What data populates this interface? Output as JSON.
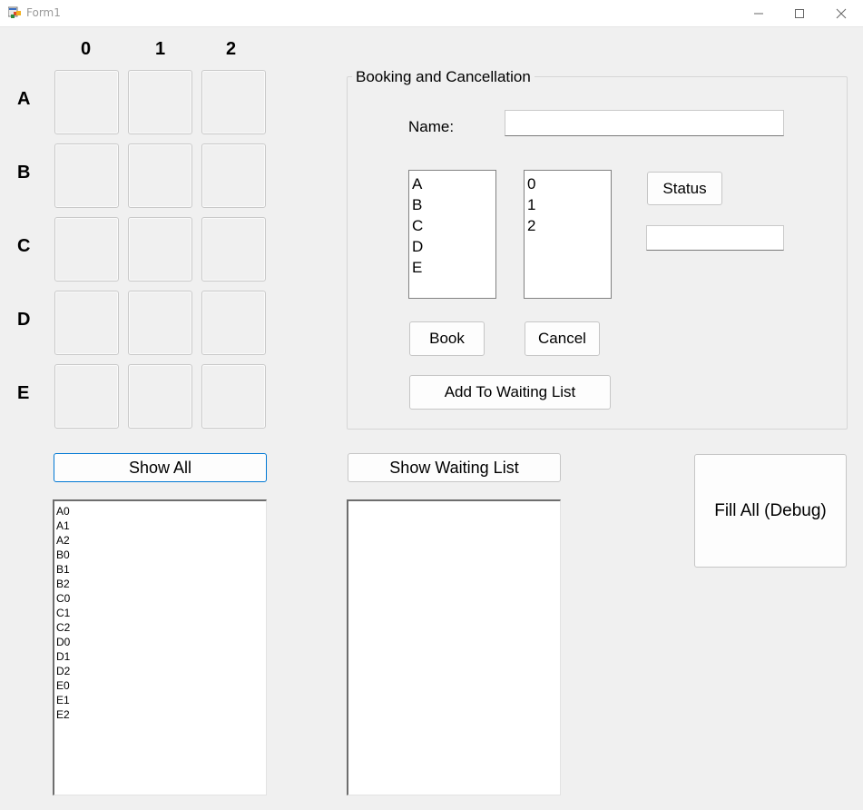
{
  "window": {
    "title": "Form1",
    "controls": [
      "minimize-icon",
      "maximize-icon",
      "close-icon"
    ]
  },
  "seat_grid": {
    "columns": [
      "0",
      "1",
      "2"
    ],
    "rows": [
      "A",
      "B",
      "C",
      "D",
      "E"
    ]
  },
  "booking": {
    "group_title": "Booking and Cancellation",
    "name_label": "Name:",
    "name_value": "",
    "row_options": [
      "A",
      "B",
      "C",
      "D",
      "E"
    ],
    "seat_options": [
      "0",
      "1",
      "2"
    ],
    "status_button": "Status",
    "status_value": "",
    "book_button": "Book",
    "cancel_button": "Cancel",
    "waiting_button": "Add To Waiting List"
  },
  "show_all": {
    "button": "Show All",
    "items": [
      "A0",
      "A1",
      "A2",
      "B0",
      "B1",
      "B2",
      "C0",
      "C1",
      "C2",
      "D0",
      "D1",
      "D2",
      "E0",
      "E1",
      "E2"
    ]
  },
  "waiting": {
    "button": "Show Waiting List",
    "items": []
  },
  "debug": {
    "fill_button": "Fill All (Debug)"
  },
  "colors": {
    "form_bg": "#f0f0f0",
    "focus_border": "#0078d4"
  }
}
